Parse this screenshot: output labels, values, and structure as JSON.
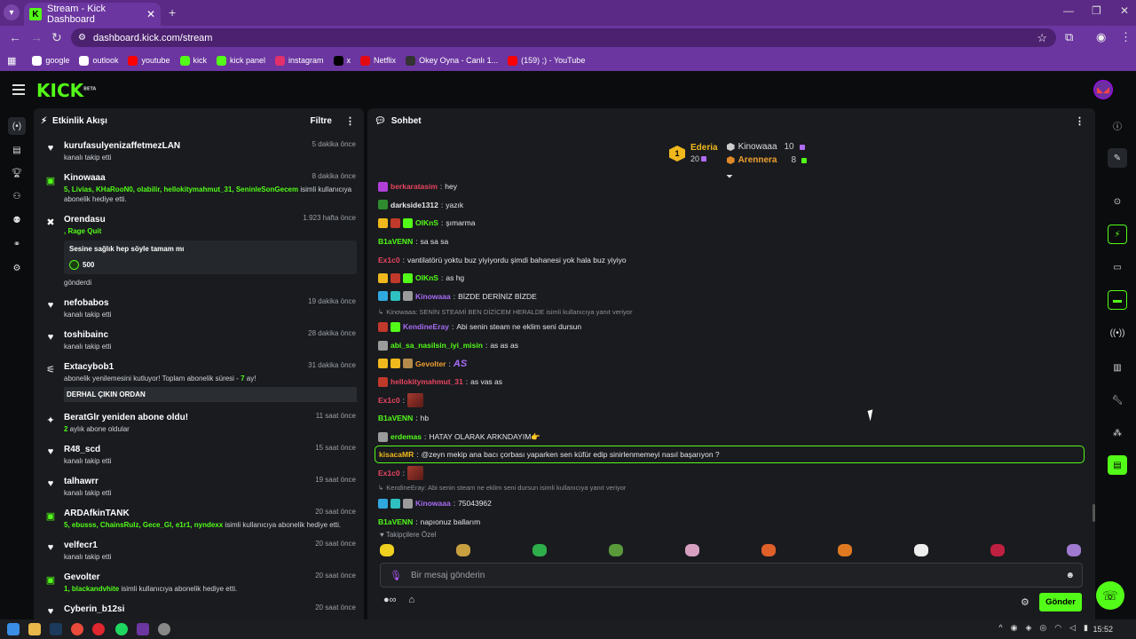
{
  "browser": {
    "tab_title": "Stream - Kick Dashboard",
    "url": "dashboard.kick.com/stream",
    "bookmarks": [
      {
        "label": "google",
        "icon": "google-icon",
        "color": "#ffffff"
      },
      {
        "label": "outlook",
        "icon": "globe-icon",
        "color": "#ffffff"
      },
      {
        "label": "youtube",
        "icon": "youtube-icon",
        "color": "#ff0000"
      },
      {
        "label": "kick",
        "icon": "kick-icon",
        "color": "#53fc18"
      },
      {
        "label": "kick panel",
        "icon": "kick-icon",
        "color": "#53fc18"
      },
      {
        "label": "instagram",
        "icon": "instagram-icon",
        "color": "#e1306c"
      },
      {
        "label": "x",
        "icon": "x-icon",
        "color": "#000000"
      },
      {
        "label": "Netflix",
        "icon": "netflix-icon",
        "color": "#e50914"
      },
      {
        "label": "Okey Oyna - Canlı 1...",
        "icon": "okey-icon",
        "color": "#333333"
      },
      {
        "label": "(159) ;) - YouTube",
        "icon": "youtube-icon",
        "color": "#ff0000"
      }
    ]
  },
  "brand": {
    "logo": "KICK",
    "beta": "BETA",
    "accent": "#53fc18"
  },
  "activity": {
    "title": "Etkinlik Akışı",
    "filter": "Filtre",
    "items": [
      {
        "icon": "heart-icon",
        "name": "kurufasulyenizaffetmezLAN",
        "time": "5 dakika önce",
        "desc": [
          {
            "t": "kanalı takip etti",
            "g": false
          }
        ]
      },
      {
        "icon": "gift-icon",
        "name": "Kinowaaa",
        "time": "8 dakika önce",
        "desc": [
          {
            "t": "5, Livias, KHaRooN0, olabilir, hellokitymahmut_31, SeninleSonGecem",
            "g": true
          },
          {
            "t": " isimli kullanıcıya abonelik hediye etti.",
            "g": false
          }
        ]
      },
      {
        "icon": "rage-icon",
        "name": "Orendasu",
        "time": "1.923 hafta önce",
        "desc": [
          {
            "t": ", Rage Quit",
            "g": true
          }
        ],
        "redeem": {
          "text": "Sesine sağlık hep söyle tamam mı",
          "points": "500"
        },
        "after": "gönderdi"
      },
      {
        "icon": "heart-icon",
        "name": "nefobabos",
        "time": "19 dakika önce",
        "desc": [
          {
            "t": "kanalı takip etti",
            "g": false
          }
        ]
      },
      {
        "icon": "heart-icon",
        "name": "toshibainc",
        "time": "28 dakika önce",
        "desc": [
          {
            "t": "kanalı takip etti",
            "g": false
          }
        ]
      },
      {
        "icon": "satellite-icon",
        "name": "Extacybob1",
        "time": "31 dakika önce",
        "desc": [
          {
            "t": "abonelik yenilemesini kutluyor! Toplam abonelik süresi - ",
            "g": false
          },
          {
            "t": "7",
            "g": true
          },
          {
            "t": " ay!",
            "g": false
          }
        ],
        "message": "DERHAL ÇIKIN ORDAN"
      },
      {
        "icon": "sparkle-icon",
        "name": "BeratGlr yeniden abone oldu!",
        "time": "11 saat önce",
        "desc": [
          {
            "t": "2",
            "g": true
          },
          {
            "t": " aylık abone oldular",
            "g": false
          }
        ]
      },
      {
        "icon": "heart-icon",
        "name": "R48_scd",
        "time": "15 saat önce",
        "desc": [
          {
            "t": "kanalı takip etti",
            "g": false
          }
        ]
      },
      {
        "icon": "heart-icon",
        "name": "talhawrr",
        "time": "19 saat önce",
        "desc": [
          {
            "t": "kanalı takip etti",
            "g": false
          }
        ]
      },
      {
        "icon": "gift-icon",
        "name": "ARDAfkinTANK",
        "time": "20 saat önce",
        "desc": [
          {
            "t": "5, ebusss, ChainsRulz, Gece_Gl, e1r1, nyndexx",
            "g": true
          },
          {
            "t": " isimli kullanıcıya abonelik hediye etti.",
            "g": false
          }
        ]
      },
      {
        "icon": "heart-icon",
        "name": "velfecr1",
        "time": "20 saat önce",
        "desc": [
          {
            "t": "kanalı takip etti",
            "g": false
          }
        ]
      },
      {
        "icon": "gift-icon",
        "name": "Gevolter",
        "time": "20 saat önce",
        "desc": [
          {
            "t": "1, blackandvhite",
            "g": true
          },
          {
            "t": " isimli kullanıcıya abonelik hediye etti.",
            "g": false
          }
        ]
      },
      {
        "icon": "heart-icon",
        "name": "Cyberin_b12si",
        "time": "20 saat önce",
        "desc": []
      }
    ]
  },
  "chat": {
    "title": "Sohbet",
    "leaderboard": {
      "first": {
        "rank": "1",
        "name": "Ederia",
        "count": "20"
      },
      "second": {
        "name": "Kinowaaa",
        "count": "10"
      },
      "third": {
        "name": "Arennera",
        "count": "8"
      }
    },
    "messages": [
      {
        "kind": "msg",
        "badges": [
          "#b03fd8"
        ],
        "user": "berkaratasim",
        "color": "#e94560",
        "text": "hey"
      },
      {
        "kind": "msg",
        "badges": [
          "#2e8b2e"
        ],
        "user": "darkside1312",
        "color": "#e6e6e6",
        "text": "yazık"
      },
      {
        "kind": "msg",
        "badges": [
          "#f0b81c",
          "#c0392b",
          "#53fc18"
        ],
        "user": "OlKnS",
        "color": "#53fc18",
        "text": "şımarma"
      },
      {
        "kind": "msg",
        "badges": [],
        "user": "B1aVENN",
        "color": "#53fc18",
        "text": "sa sa sa"
      },
      {
        "kind": "msg",
        "badges": [],
        "user": "Ex1c0",
        "color": "#e94560",
        "text": "vantilatörü yoktu buz yiyiyordu şimdi bahanesi yok hala buz yiyiyo"
      },
      {
        "kind": "msg",
        "badges": [
          "#f0b81c",
          "#c0392b",
          "#53fc18"
        ],
        "user": "OlKnS",
        "color": "#53fc18",
        "text": "as hg"
      },
      {
        "kind": "msg",
        "badges": [
          "#2fa8e0",
          "#2fc0c0",
          "#9b9b9b"
        ],
        "user": "Kinowaaa",
        "color": "#a86cf5",
        "text": "BİZDE DERİNİZ BİZDE"
      },
      {
        "kind": "reply",
        "text": "Kinowaaa: SENİN STEAMİ BEN DİZİCEM HERALDE isimli kullanıcıya yanıt veriyor"
      },
      {
        "kind": "msg",
        "badges": [
          "#c0392b",
          "#53fc18"
        ],
        "user": "KendineEray",
        "color": "#a86cf5",
        "text": "Abi senin steam ne eklim seni dursun"
      },
      {
        "kind": "msg",
        "badges": [
          "#9b9b9b"
        ],
        "user": "abi_sa_nasilsin_iyi_misin",
        "color": "#53fc18",
        "text": "as as as"
      },
      {
        "kind": "msg",
        "badges": [
          "#f0b81c",
          "#f0b81c",
          "#b58b4c"
        ],
        "user": "Gevolter",
        "color": "#f0a030",
        "text": "",
        "emote": "AS"
      },
      {
        "kind": "msg",
        "badges": [
          "#c0392b"
        ],
        "user": "hellokitymahmut_31",
        "color": "#e94560",
        "text": "as vas as"
      },
      {
        "kind": "msg",
        "badges": [],
        "user": "Ex1c0",
        "color": "#e94560",
        "text": "",
        "img": true
      },
      {
        "kind": "msg",
        "badges": [],
        "user": "B1aVENN",
        "color": "#53fc18",
        "text": "hb"
      },
      {
        "kind": "msg",
        "badges": [
          "#9b9b9b"
        ],
        "user": "erdemas",
        "color": "#53fc18",
        "text": "HATAY OLARAK ARKNDAYIM👉"
      },
      {
        "kind": "msg",
        "badges": [],
        "user": "kisacaMR",
        "color": "#f0b81c",
        "text": "@zeyn mekip ana bacı çorbası yaparken sen küfür edip sinirlenmemeyi nasıl başarıyon ?",
        "highlight": true
      },
      {
        "kind": "msg",
        "badges": [],
        "user": "Ex1c0",
        "color": "#e94560",
        "text": "",
        "img": true
      },
      {
        "kind": "reply",
        "text": "KendineEray: Abi senin steam ne eklim seni dursun isimli kullanıcıya yanıt veriyor"
      },
      {
        "kind": "msg",
        "badges": [
          "#2fa8e0",
          "#2fc0c0",
          "#9b9b9b"
        ],
        "user": "Kinowaaa",
        "color": "#a86cf5",
        "text": "75043962"
      },
      {
        "kind": "msg",
        "badges": [],
        "user": "B1aVENN",
        "color": "#53fc18",
        "text": "napıonuz ballarım"
      }
    ],
    "follower_label": "Takipçilere Özel",
    "emotes": [
      "#f0d020",
      "#c9a040",
      "#2eae4a",
      "#5a9a3a",
      "#d8a0c0",
      "#e0602a",
      "#e07a20",
      "#eeeeee",
      "#c02040",
      "#a07ad0"
    ],
    "input_placeholder": "Bir mesaj gönderin",
    "send_label": "Gönder"
  },
  "taskbar": {
    "time": "15:52"
  }
}
